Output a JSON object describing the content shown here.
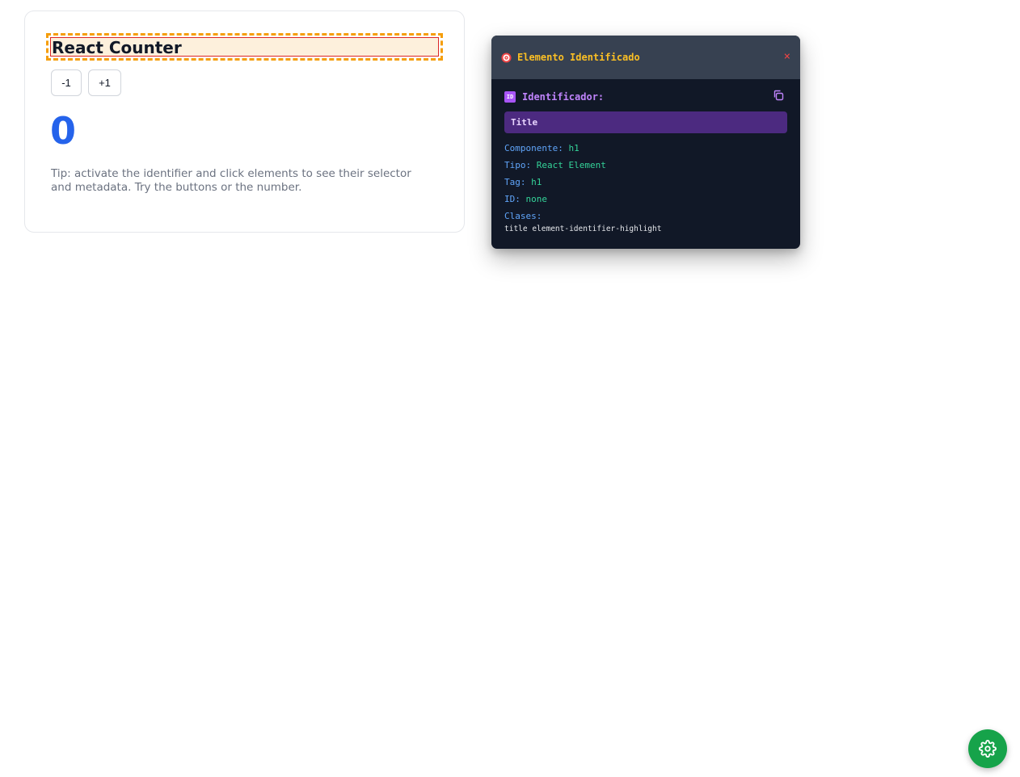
{
  "counter": {
    "title": "React Counter",
    "decrement_label": "-1",
    "increment_label": "+1",
    "count": "0",
    "tip": "Tip: activate the identifier and click elements to see their selector and metadata. Try the buttons or the number.",
    "count_color": "#2563eb"
  },
  "panel": {
    "title": "Elemento Identificado",
    "close_label": "×",
    "identifier_badge": "ID",
    "identifier_label": "Identificador:",
    "identifier_value": "Title",
    "componente_key": "Componente:",
    "componente_val": "h1",
    "tipo_key": "Tipo:",
    "tipo_val": "React Element",
    "tag_key": "Tag:",
    "tag_val": "h1",
    "id_key": "ID:",
    "id_val": "none",
    "clases_key": "Clases:",
    "clases_val": "title element-identifier-highlight",
    "icons": {
      "target": "target-icon",
      "copy": "copy-icon",
      "close": "close-icon"
    }
  },
  "fab": {
    "icon": "gear-icon",
    "color": "#16a34a"
  }
}
